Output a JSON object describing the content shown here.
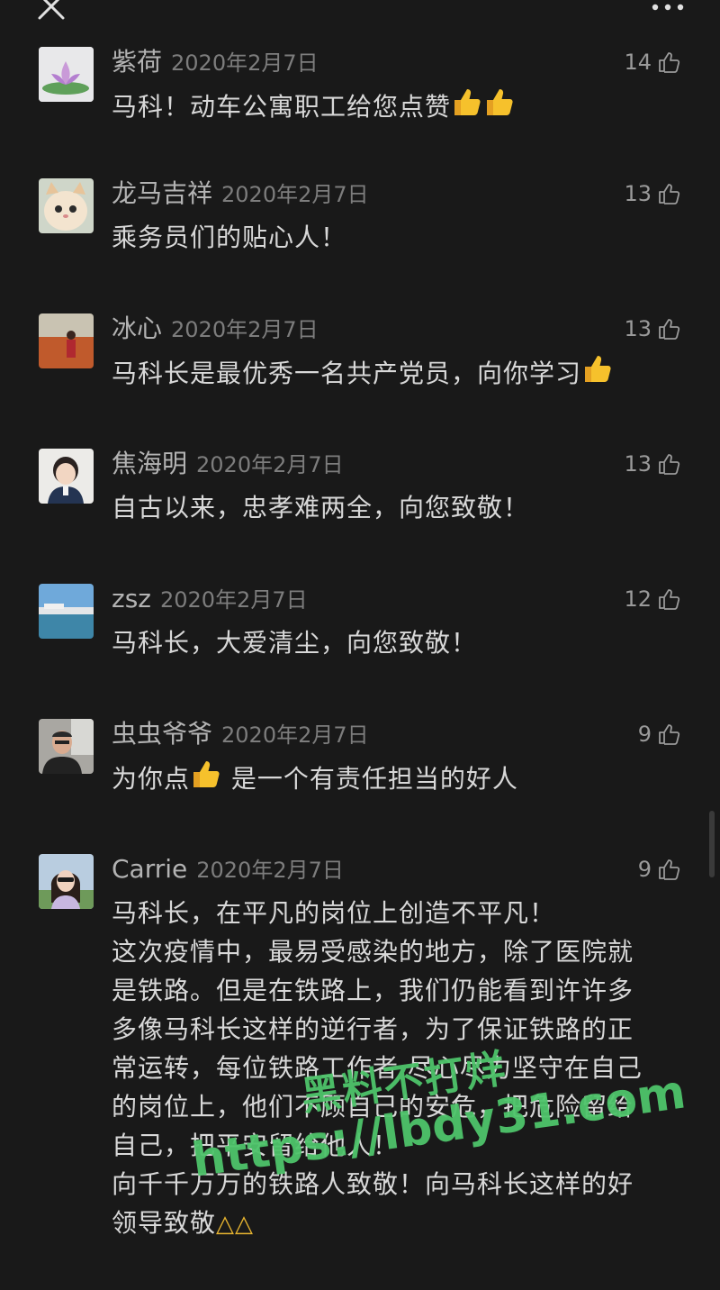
{
  "comments": [
    {
      "name": "紫荷",
      "date": "2020年2月7日",
      "likes": "14",
      "text": "马科！动车公寓职工给您点赞",
      "thumbs_after": 2,
      "avatar": "lotus-flower"
    },
    {
      "name": "龙马吉祥",
      "date": "2020年2月7日",
      "likes": "13",
      "text": "乘务员们的贴心人！",
      "thumbs_after": 0,
      "avatar": "kitten"
    },
    {
      "name": "冰心",
      "date": "2020年2月7日",
      "likes": "13",
      "text": "马科长是最优秀一名共产党员，向你学习",
      "thumbs_after": 1,
      "avatar": "field-person"
    },
    {
      "name": "焦海明",
      "date": "2020年2月7日",
      "likes": "13",
      "text": "自古以来，忠孝难两全，向您致敬！",
      "thumbs_after": 0,
      "avatar": "child-portrait"
    },
    {
      "name": "zsz",
      "date": "2020年2月7日",
      "likes": "12",
      "text": "马科长，大爱清尘，向您致敬！",
      "thumbs_after": 0,
      "avatar": "lake-landscape"
    },
    {
      "name": "虫虫爷爷",
      "date": "2020年2月7日",
      "likes": "9",
      "text_before": "为你点",
      "text_after": " 是一个有责任担当的好人",
      "avatar": "man-portrait"
    },
    {
      "name": "Carrie",
      "date": "2020年2月7日",
      "likes": "9",
      "lines": [
        "马科长，在平凡的岗位上创造不平凡！",
        "这次疫情中，最易受感染的地方，除了医院就",
        "是铁路。但是在铁路上，我们仍能看到许许多",
        "多像马科长这样的逆行者，为了保证铁路的正",
        "常运转，每位铁路工作者 尽心尽力坚守在自己",
        "的岗位上，他们不顾自己的安危，把危险留给",
        "自己，把平安留给他人！",
        "向千千万万的铁路人致敬！向马科长这样的好",
        "领导致敬"
      ],
      "avatar": "woman-portrait"
    }
  ],
  "watermark": {
    "line1": "黑料不打烊",
    "line2": "https://lbdy31.com"
  },
  "colors": {
    "background": "#191919",
    "name": "#b3b3b3",
    "date": "#7d7d7d",
    "text": "#d8d8d8",
    "watermark": "#4ec46b"
  }
}
